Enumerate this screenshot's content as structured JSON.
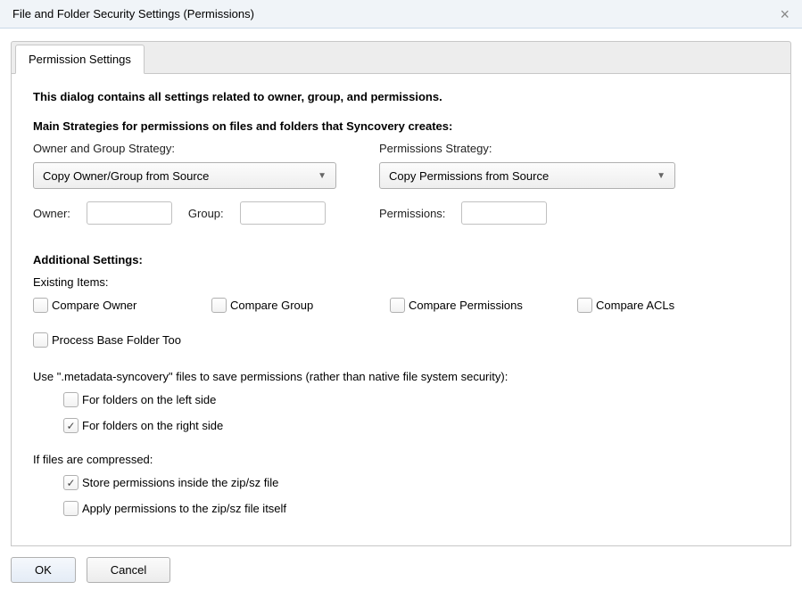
{
  "window": {
    "title": "File and Folder Security Settings (Permissions)"
  },
  "tabs": {
    "permission_settings": "Permission Settings"
  },
  "dialog": {
    "description": "This dialog contains all settings related to owner, group, and permissions.",
    "main_strategies_heading": "Main Strategies for permissions on files and folders that Syncovery creates:",
    "owner_group_strategy_label": "Owner and Group Strategy:",
    "owner_group_strategy_value": "Copy Owner/Group from Source",
    "permissions_strategy_label": "Permissions Strategy:",
    "permissions_strategy_value": "Copy Permissions from Source",
    "owner_label": "Owner:",
    "group_label": "Group:",
    "permissions_field_label": "Permissions:",
    "additional_settings_heading": "Additional Settings:",
    "existing_items_label": "Existing Items:",
    "compare_owner": "Compare Owner",
    "compare_group": "Compare Group",
    "compare_permissions": "Compare Permissions",
    "compare_acls": "Compare ACLs",
    "process_base_folder": "Process Base Folder Too",
    "metadata_intro": "Use \".metadata-syncovery\" files to save permissions (rather than native file system security):",
    "folders_left": "For folders on the left side",
    "folders_right": "For folders on the right side",
    "compressed_intro": "If files are compressed:",
    "store_inside_zip": "Store permissions inside the zip/sz file",
    "apply_to_zip": "Apply permissions to the zip/sz file itself",
    "ok": "OK",
    "cancel": "Cancel"
  }
}
